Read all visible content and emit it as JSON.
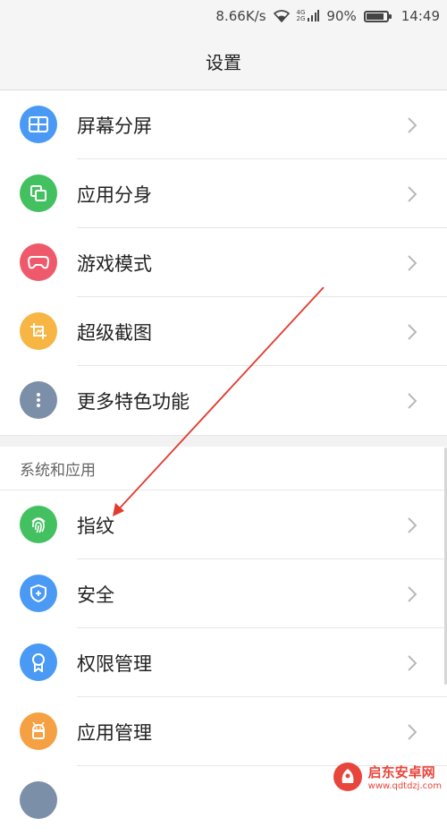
{
  "status_bar": {
    "speed": "8.66K/s",
    "network_top": "4G",
    "network_bottom": "2G",
    "battery": "90%",
    "battery_level": 0.9,
    "time": "14:49"
  },
  "header": {
    "title": "设置"
  },
  "groups": [
    {
      "items": [
        {
          "label": "屏幕分屏",
          "icon": "split-screen-icon",
          "color": "#4a9af5"
        },
        {
          "label": "应用分身",
          "icon": "app-clone-icon",
          "color": "#43c160"
        },
        {
          "label": "游戏模式",
          "icon": "gamepad-icon",
          "color": "#ee5a6b"
        },
        {
          "label": "超级截图",
          "icon": "screenshot-crop-icon",
          "color": "#f7b544"
        },
        {
          "label": "更多特色功能",
          "icon": "more-dots-icon",
          "color": "#7b8fa8"
        }
      ]
    },
    {
      "title": "系统和应用",
      "items": [
        {
          "label": "指纹",
          "icon": "fingerprint-icon",
          "color": "#43c160"
        },
        {
          "label": "安全",
          "icon": "shield-icon",
          "color": "#4a9af5"
        },
        {
          "label": "权限管理",
          "icon": "badge-icon",
          "color": "#4a9af5"
        },
        {
          "label": "应用管理",
          "icon": "android-icon",
          "color": "#f5a042"
        }
      ]
    }
  ],
  "watermark": {
    "title": "启东安卓网",
    "url": "www.qdtdzj.com"
  }
}
